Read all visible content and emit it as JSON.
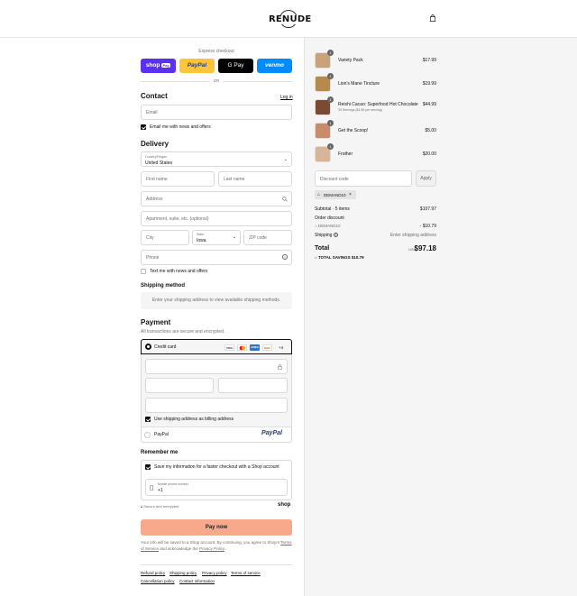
{
  "header": {
    "brand": "RENUDE",
    "cart_icon": "shopping-bag-icon"
  },
  "express": {
    "title": "Express checkout",
    "buttons": [
      {
        "label": "shop",
        "suffix": "Pay",
        "color": "#5a31f4"
      },
      {
        "label": "PayPal",
        "color": "#ffc439"
      },
      {
        "label": "G Pay",
        "color": "#000000"
      },
      {
        "label": "venmo",
        "color": "#008cff"
      }
    ],
    "or": "OR"
  },
  "contact": {
    "title": "Contact",
    "login": "Log in",
    "email_placeholder": "Email",
    "news_label": "Email me with news and offers"
  },
  "delivery": {
    "title": "Delivery",
    "country_label": "Country/Region",
    "country_value": "United States",
    "first_name": "First name",
    "last_name": "Last name",
    "address": "Address",
    "apartment": "Apartment, suite, etc. (optional)",
    "city": "City",
    "state_label": "State",
    "state_value": "Iowa",
    "zip": "ZIP code",
    "phone": "Phone",
    "text_label": "Text me with news and offers"
  },
  "shipping": {
    "title": "Shipping method",
    "note": "Enter your shipping address to view available shipping methods."
  },
  "payment": {
    "title": "Payment",
    "subtitle": "All transactions are secure and encrypted.",
    "credit_card": "Credit card",
    "more_cards": "+4",
    "billing_label": "Use shipping address as billing address",
    "paypal_label": "PayPal",
    "paypal_logo": "PayPal"
  },
  "remember": {
    "title": "Remember me",
    "save_label": "Save my information for a faster checkout with a Shop account",
    "phone_label": "Mobile phone number",
    "phone_value": "+1",
    "secure": "Secure and encrypted",
    "shop_logo": "shop"
  },
  "pay_button": {
    "label": "Pay now",
    "color": "#f8a98c"
  },
  "legal": {
    "text1": "Your info will be saved to a Shop account. By continuing, you agree to Shop's",
    "terms": "Terms of Service",
    "text2": "and acknowledge the",
    "privacy": "Privacy Policy",
    "end": "."
  },
  "footer_links": [
    "Refund policy",
    "Shipping policy",
    "Privacy policy",
    "Terms of service",
    "Cancellation policy",
    "Contact information"
  ],
  "cart": {
    "items": [
      {
        "name": "Variety Pack",
        "qty": "1",
        "price": "$17.99",
        "sub": "",
        "color": "#c9a27a"
      },
      {
        "name": "Lion's Mane Tincture",
        "qty": "1",
        "price": "$19.99",
        "sub": "",
        "color": "#b58a4c"
      },
      {
        "name": "Reishi Cacao: Superfood Hot Chocolate",
        "qty": "1",
        "price": "$44.99",
        "sub": "30 Servings ($1.50 per serving)",
        "color": "#7a4a32"
      },
      {
        "name": "Get the Scoop!",
        "qty": "1",
        "price": "$5.00",
        "sub": "",
        "color": "#c98b6a"
      },
      {
        "name": "Frother",
        "qty": "1",
        "price": "$20.00",
        "sub": "",
        "color": "#d6b59a"
      }
    ],
    "discount_placeholder": "Discount code",
    "apply": "Apply",
    "code_tag": "DEMAND10",
    "subtotal_label": "Subtotal · 5 items",
    "subtotal": "$107.97",
    "order_discount": "Order discount",
    "code_line": "DEMAND10",
    "discount_value": "- $10.79",
    "shipping_label": "Shipping",
    "shipping_value": "Enter shipping address",
    "total_label": "Total",
    "currency": "USD",
    "total": "$97.18",
    "savings_label": "TOTAL SAVINGS",
    "savings": "$10.79"
  }
}
